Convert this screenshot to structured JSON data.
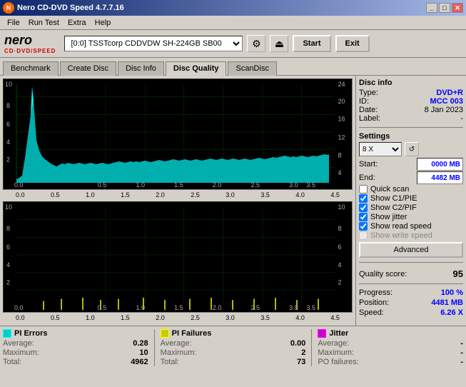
{
  "titlebar": {
    "title": "Nero CD-DVD Speed 4.7.7.16",
    "buttons": [
      "_",
      "□",
      "✕"
    ]
  },
  "menu": {
    "items": [
      "File",
      "Run Test",
      "Extra",
      "Help"
    ]
  },
  "toolbar": {
    "drive": "[0:0]  TSSTcorp CDDVDW SH-224GB SB00",
    "start_label": "Start",
    "exit_label": "Exit"
  },
  "tabs": {
    "items": [
      "Benchmark",
      "Create Disc",
      "Disc Info",
      "Disc Quality",
      "ScanDisc"
    ],
    "active": "Disc Quality"
  },
  "disc_info": {
    "section_title": "Disc info",
    "type_label": "Type:",
    "type_value": "DVD+R",
    "id_label": "ID:",
    "id_value": "MCC 003",
    "date_label": "Date:",
    "date_value": "8 Jan 2023",
    "label_label": "Label:",
    "label_value": "-"
  },
  "settings": {
    "section_title": "Settings",
    "speed_value": "8 X",
    "start_label": "Start:",
    "start_value": "0000 MB",
    "end_label": "End:",
    "end_value": "4482 MB",
    "checkboxes": [
      {
        "id": "quick_scan",
        "label": "Quick scan",
        "checked": false,
        "enabled": true
      },
      {
        "id": "show_c1_pie",
        "label": "Show C1/PIE",
        "checked": true,
        "enabled": true
      },
      {
        "id": "show_c2_pif",
        "label": "Show C2/PIF",
        "checked": true,
        "enabled": true
      },
      {
        "id": "show_jitter",
        "label": "Show jitter",
        "checked": true,
        "enabled": true
      },
      {
        "id": "show_read_speed",
        "label": "Show read speed",
        "checked": true,
        "enabled": true
      },
      {
        "id": "show_write_speed",
        "label": "Show write speed",
        "checked": false,
        "enabled": false
      }
    ],
    "advanced_label": "Advanced"
  },
  "quality": {
    "label": "Quality score:",
    "score": "95"
  },
  "progress": {
    "progress_label": "Progress:",
    "progress_value": "100 %",
    "position_label": "Position:",
    "position_value": "4481 MB",
    "speed_label": "Speed:",
    "speed_value": "6.26 X"
  },
  "chart1": {
    "y_max": 10,
    "y_labels_left": [
      "10",
      "8",
      "6",
      "4",
      "2"
    ],
    "y_labels_right": [
      "24",
      "20",
      "16",
      "12",
      "8",
      "4"
    ],
    "x_labels": [
      "0.0",
      "0.5",
      "1.0",
      "1.5",
      "2.0",
      "2.5",
      "3.0",
      "3.5",
      "4.0",
      "4.5"
    ]
  },
  "chart2": {
    "y_max": 10,
    "y_labels_left": [
      "10",
      "8",
      "6",
      "4",
      "2"
    ],
    "y_labels_right": [
      "10",
      "8",
      "6",
      "4",
      "2"
    ],
    "x_labels": [
      "0.0",
      "0.5",
      "1.0",
      "1.5",
      "2.0",
      "2.5",
      "3.0",
      "3.5",
      "4.0",
      "4.5"
    ]
  },
  "stats": {
    "pi_errors": {
      "color": "#00ffff",
      "label": "PI Errors",
      "avg_label": "Average:",
      "avg_value": "0.28",
      "max_label": "Maximum:",
      "max_value": "10",
      "total_label": "Total:",
      "total_value": "4962"
    },
    "pi_failures": {
      "color": "#ffff00",
      "label": "PI Failures",
      "avg_label": "Average:",
      "avg_value": "0.00",
      "max_label": "Maximum:",
      "max_value": "2",
      "total_label": "Total:",
      "total_value": "73"
    },
    "jitter": {
      "color": "#ff00ff",
      "label": "Jitter",
      "avg_label": "Average:",
      "avg_value": "-",
      "max_label": "Maximum:",
      "max_value": "-",
      "po_label": "PO failures:",
      "po_value": "-"
    }
  }
}
